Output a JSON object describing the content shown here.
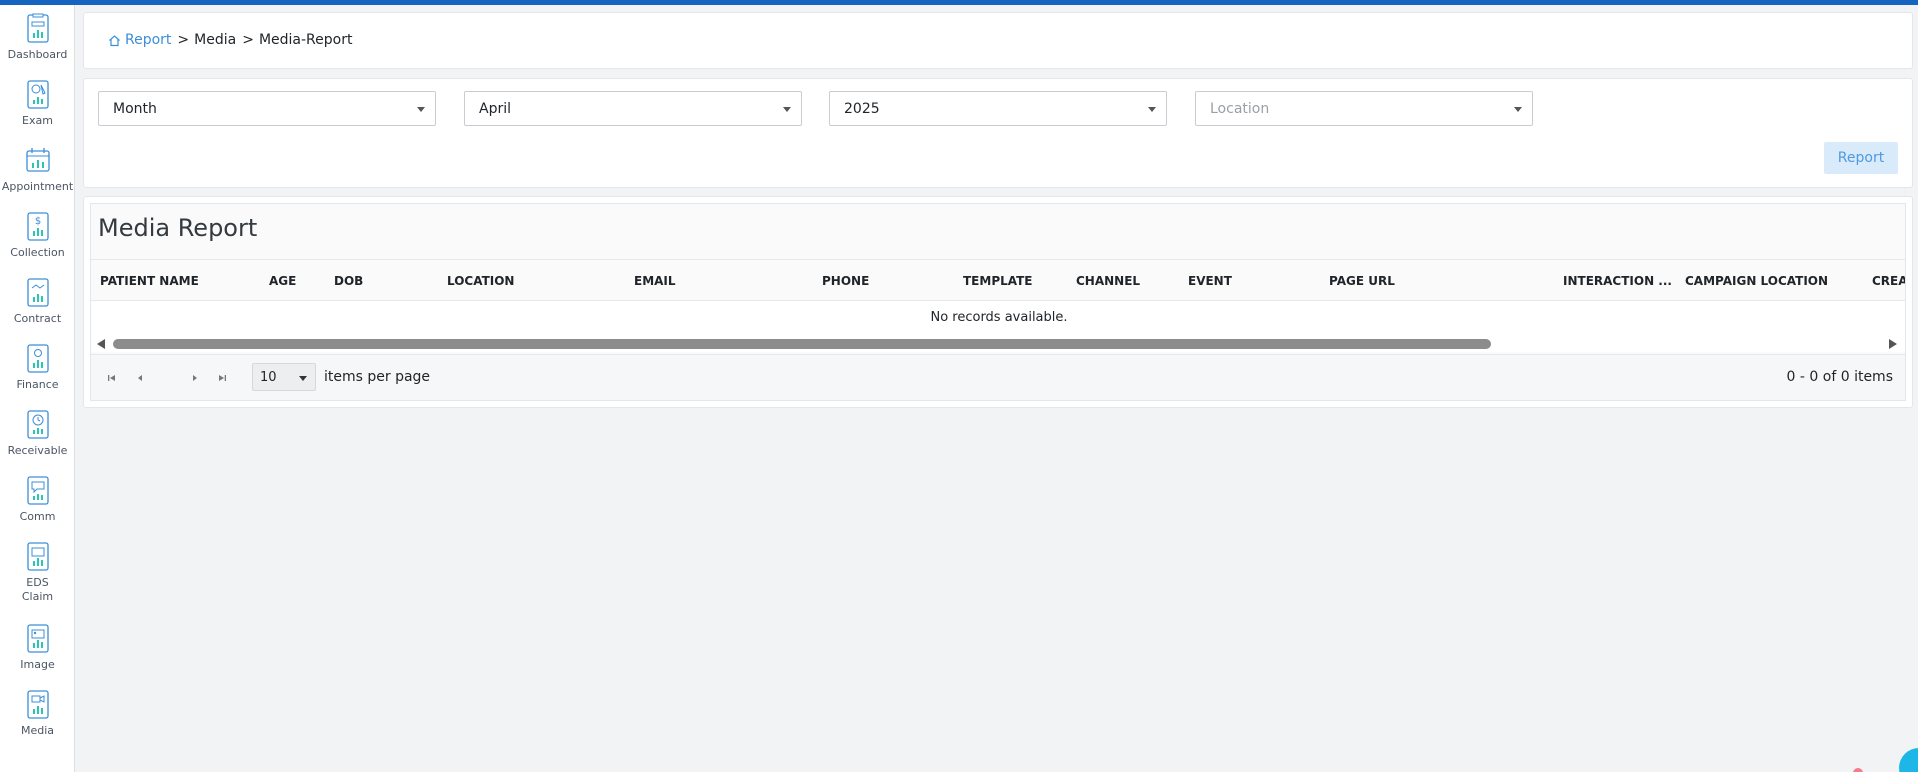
{
  "sidebar": {
    "items": [
      {
        "label": "Dashboard",
        "icon": "dashboard-report-icon"
      },
      {
        "label": "Exam",
        "icon": "exam-report-icon"
      },
      {
        "label": "Appointment",
        "icon": "appointment-report-icon"
      },
      {
        "label": "Collection",
        "icon": "collection-report-icon"
      },
      {
        "label": "Contract",
        "icon": "contract-report-icon"
      },
      {
        "label": "Finance",
        "icon": "finance-report-icon"
      },
      {
        "label": "Receivable",
        "icon": "receivable-report-icon"
      },
      {
        "label": "Comm",
        "icon": "comm-report-icon"
      },
      {
        "label": "EDS\nClaim",
        "icon": "eds-claim-report-icon"
      },
      {
        "label": "Image",
        "icon": "image-report-icon"
      },
      {
        "label": "Media",
        "icon": "media-report-icon"
      }
    ]
  },
  "breadcrumb": {
    "home": "Report",
    "items": [
      "Media",
      "Media-Report"
    ],
    "separator": ">"
  },
  "filters": {
    "period_type": "Month",
    "month": "April",
    "year": "2025",
    "location_placeholder": "Location",
    "report_button": "Report"
  },
  "grid": {
    "title": "Media Report",
    "columns": [
      "PATIENT NAME",
      "AGE",
      "DOB",
      "LOCATION",
      "EMAIL",
      "PHONE",
      "TEMPLATE",
      "CHANNEL",
      "EVENT",
      "PAGE URL",
      "INTERACTION ...",
      "CAMPAIGN LOCATION",
      "CREAT"
    ],
    "empty_message": "No records available.",
    "pager": {
      "page_size": "10",
      "items_per_page_label": "items per page",
      "info": "0 - 0 of 0 items"
    }
  },
  "colors": {
    "accent": "#1565c0",
    "link": "#3b8fd9",
    "icon": "#3b8fd9",
    "icon_chart": "#2cc4b4",
    "report_button_bg": "#d9ebfb"
  }
}
